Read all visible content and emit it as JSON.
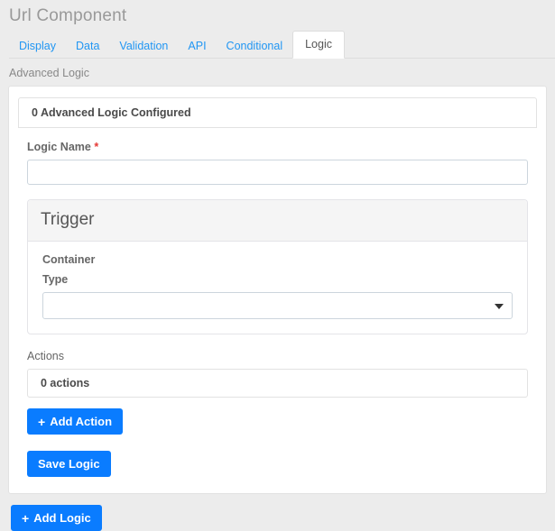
{
  "header": {
    "title": "Url Component"
  },
  "tabs": [
    {
      "label": "Display",
      "active": false
    },
    {
      "label": "Data",
      "active": false
    },
    {
      "label": "Validation",
      "active": false
    },
    {
      "label": "API",
      "active": false
    },
    {
      "label": "Conditional",
      "active": false
    },
    {
      "label": "Logic",
      "active": true
    }
  ],
  "section": {
    "advanced_logic_label": "Advanced Logic",
    "configured_summary": "0 Advanced Logic Configured"
  },
  "form": {
    "logic_name_label": "Logic Name",
    "required_marker": "*",
    "logic_name_value": "",
    "logic_name_placeholder": ""
  },
  "trigger": {
    "heading": "Trigger",
    "container_label": "Container",
    "type_label": "Type",
    "type_value": "",
    "type_options": [
      ""
    ]
  },
  "actions": {
    "label": "Actions",
    "summary": "0 actions",
    "add_action_button": "Add Action",
    "plus_glyph": "+"
  },
  "buttons": {
    "save_logic": "Save Logic",
    "add_logic": "Add Logic",
    "plus_glyph": "+"
  },
  "colors": {
    "primary": "#0a7cff",
    "tab_link": "#2196f3",
    "required": "#e53935",
    "page_bg": "#ececec",
    "panel_bg": "#ffffff",
    "trigger_header_bg": "#f5f5f5"
  }
}
